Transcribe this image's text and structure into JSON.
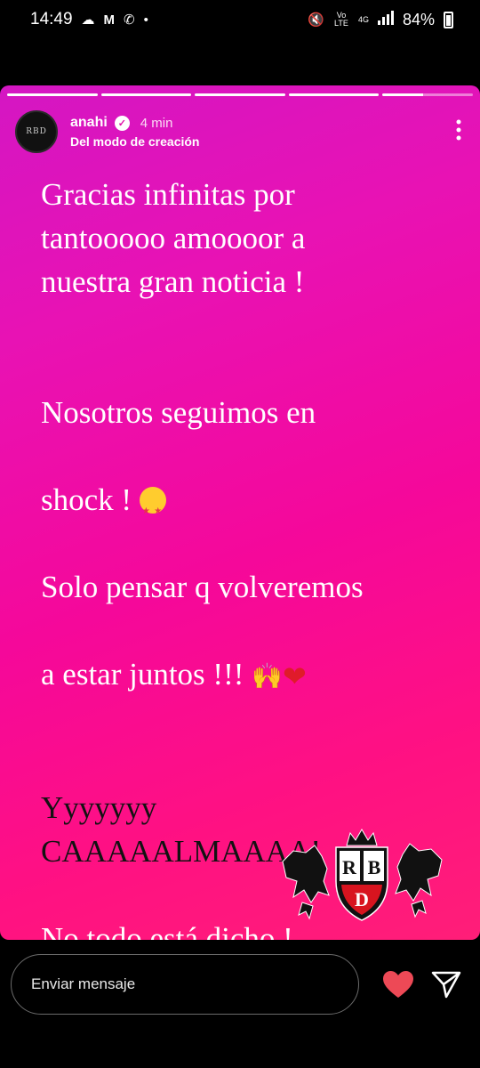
{
  "status_bar": {
    "time": "14:49",
    "battery": "84%",
    "network": "4G",
    "carrier_label": "Vo LTE",
    "icons": [
      "cloud-icon",
      "gmail-icon",
      "missed-call-icon",
      "dot-icon",
      "mute-icon",
      "volte-icon",
      "4g-icon",
      "signal-icon",
      "battery-icon"
    ]
  },
  "story": {
    "progress_segments": 5,
    "username": "anahi",
    "verified": true,
    "time_ago": "4 min",
    "subtitle": "Del modo de creación",
    "avatar_mark": "RBD",
    "text": {
      "p1": "Gracias infinitas por\ntantooooo amoooor a\nnuestra gran noticia !",
      "p2_line1": "Nosotros seguimos en",
      "p2_line2": "shock ! ",
      "p2_line3": "Solo pensar q volveremos",
      "p2_line4": "a estar juntos !!! ",
      "p3": "Yyyyyyy\nCAAAAALMAAAA!",
      "p4": "No todo está dicho !"
    },
    "emojis": [
      "star-struck-icon",
      "raising-hands-icon",
      "heart-icon",
      "winking-face-icon"
    ],
    "logo": {
      "letters": [
        "R",
        "B",
        "D"
      ]
    },
    "colors": {
      "gradient_top": "#d416c3",
      "gradient_bottom": "#ff1e78",
      "dark_text": "#121212"
    }
  },
  "bottom_bar": {
    "message_placeholder": "Enviar mensaje",
    "like_color": "#ed4956"
  }
}
